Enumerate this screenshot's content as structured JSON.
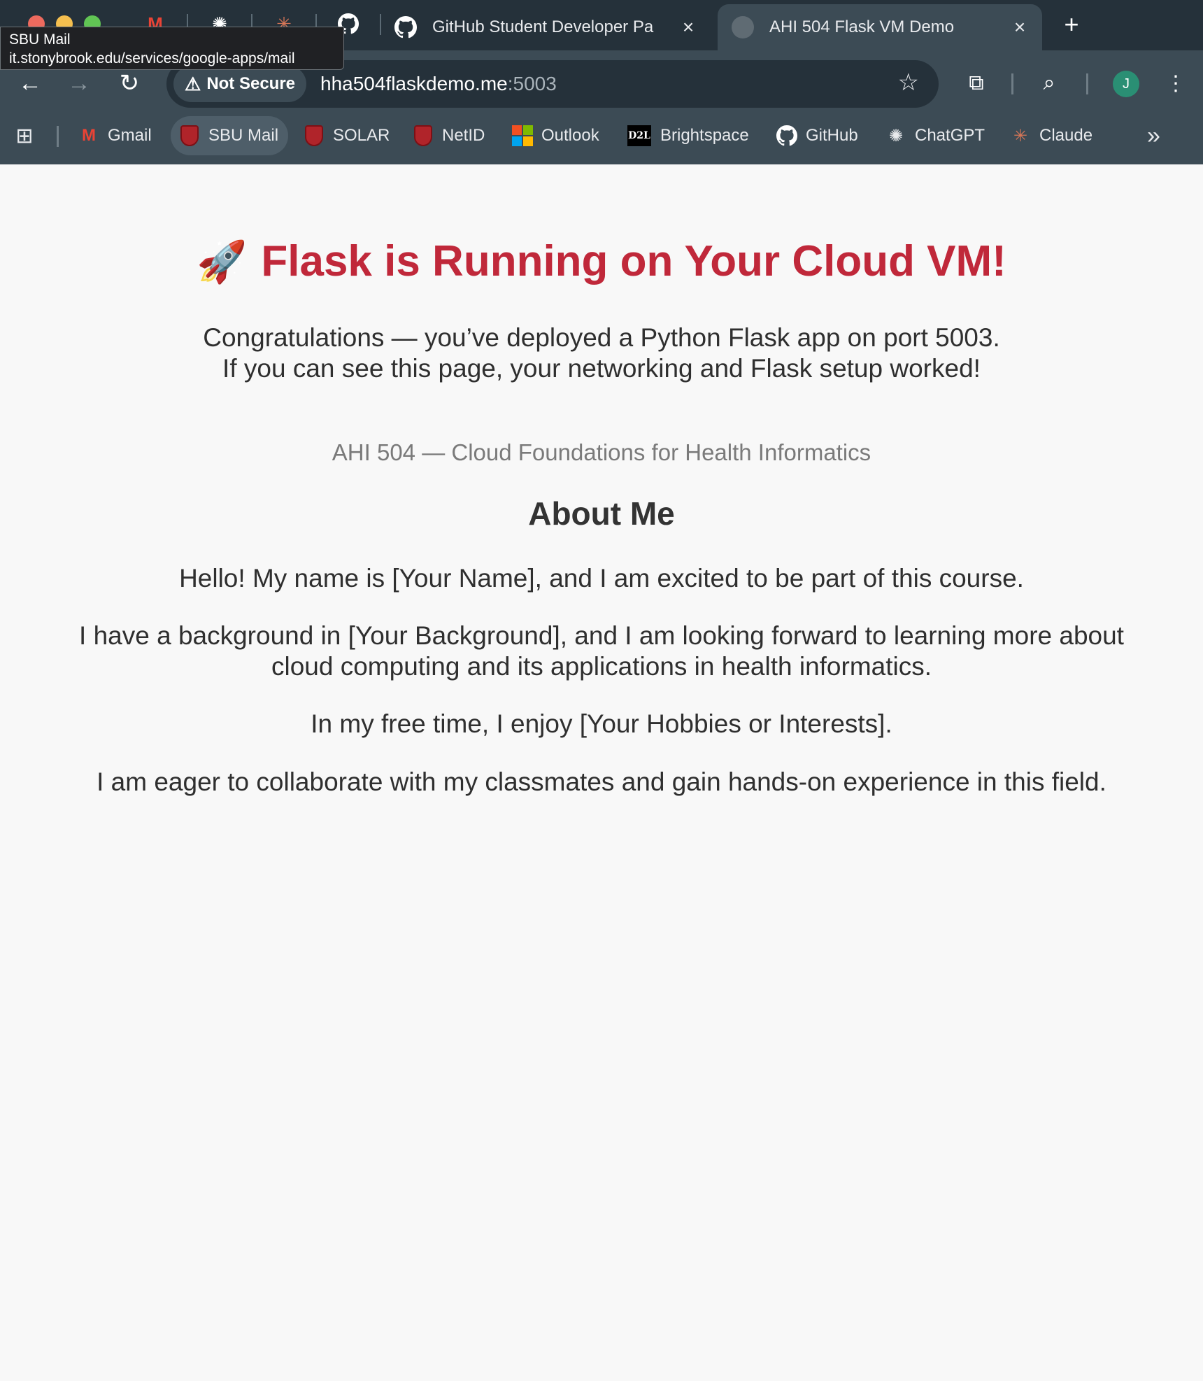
{
  "browser": {
    "pinned_tabs": [
      "gmail-icon",
      "chatgpt-icon",
      "claude-icon",
      "github-icon"
    ],
    "tabs": [
      {
        "title": "GitHub Student Developer Pa",
        "close": "×"
      },
      {
        "title": "AHI 504 Flask VM Demo",
        "close": "×"
      }
    ],
    "new_tab": "+",
    "tooltip": {
      "title": "SBU Mail",
      "url": "it.stonybrook.edu/services/google-apps/mail"
    },
    "security_chip": "Not Secure",
    "url": {
      "host": "hha504flaskdemo.me",
      "port": ":5003"
    },
    "profile_initial": "J",
    "bookmarks": [
      "Gmail",
      "SBU Mail",
      "SOLAR",
      "NetID",
      "Outlook",
      "Brightspace",
      "GitHub",
      "ChatGPT",
      "Claude"
    ],
    "more_bookmarks": "»",
    "colors": {
      "frame": "#25313a",
      "toolbar": "#3c4b55",
      "heading": "#c0283a"
    }
  },
  "page": {
    "title_emoji": "🚀",
    "title": "Flask is Running on Your Cloud VM!",
    "intro_line1": "Congratulations — you’ve deployed a Python Flask app on port 5003.",
    "intro_line2": "If you can see this page, your networking and Flask setup worked!",
    "course": "AHI 504 — Cloud Foundations for Health Informatics",
    "about_heading": "About Me",
    "about": [
      "Hello! My name is [Your Name], and I am excited to be part of this course.",
      "I have a background in [Your Background], and I am looking forward to learning more about cloud computing and its applications in health informatics.",
      "In my free time, I enjoy [Your Hobbies or Interests].",
      "I am eager to collaborate with my classmates and gain hands-on experience in this field."
    ]
  }
}
